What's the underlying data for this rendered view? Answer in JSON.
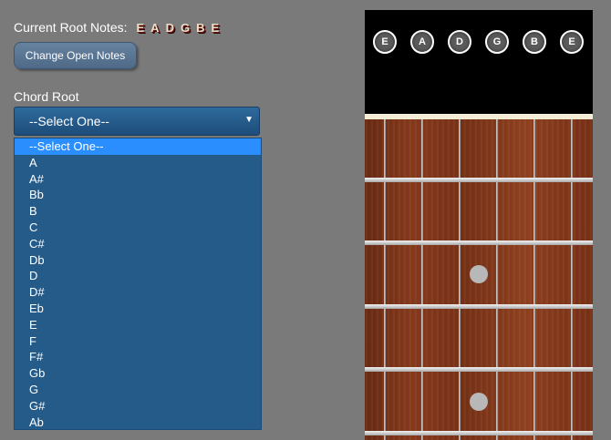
{
  "header": {
    "current_root_label": "Current Root Notes:",
    "root_notes": [
      "E",
      "A",
      "D",
      "G",
      "B",
      "E"
    ]
  },
  "buttons": {
    "change_open_notes": "Change Open Notes"
  },
  "chord_root": {
    "label": "Chord Root",
    "selected": "--Select One--",
    "options": [
      "--Select One--",
      "A",
      "A#",
      "Bb",
      "B",
      "C",
      "C#",
      "Db",
      "D",
      "D#",
      "Eb",
      "E",
      "F",
      "F#",
      "Gb",
      "G",
      "G#",
      "Ab"
    ]
  },
  "fretboard": {
    "string_buttons": [
      "E",
      "A",
      "D",
      "G",
      "B",
      "E"
    ],
    "inlay_markers": [
      "fret-3",
      "fret-5"
    ]
  }
}
